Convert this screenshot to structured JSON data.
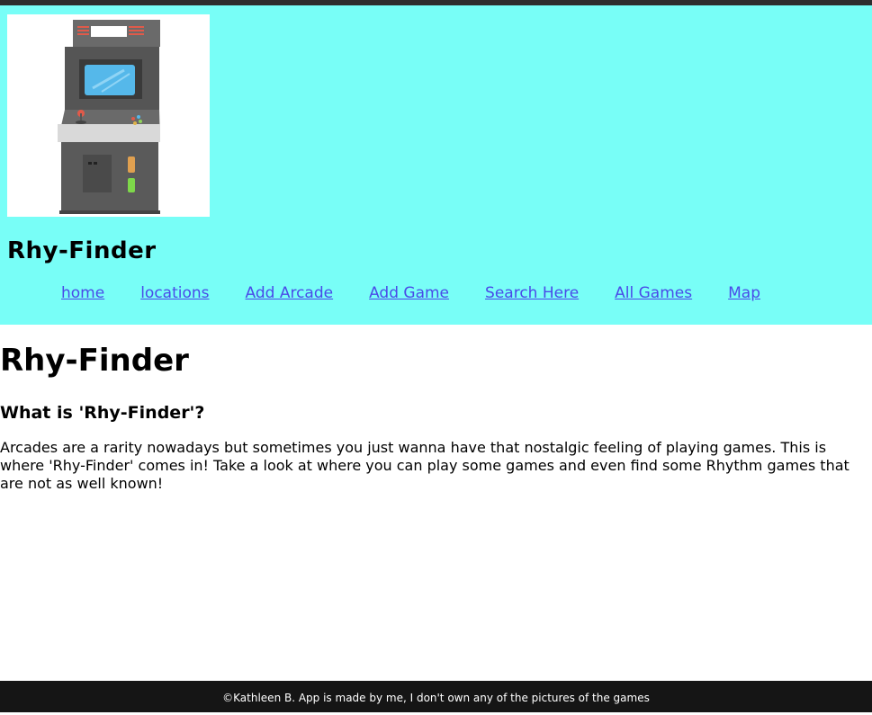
{
  "header": {
    "site_title": "Rhy-Finder",
    "logo_icon": "arcade-cabinet-icon",
    "background": "#78fef7"
  },
  "nav": {
    "items": [
      {
        "label": "home"
      },
      {
        "label": "locations"
      },
      {
        "label": "Add Arcade"
      },
      {
        "label": "Add Game"
      },
      {
        "label": "Search Here"
      },
      {
        "label": "All Games"
      },
      {
        "label": "Map"
      }
    ],
    "link_color": "#4a4ae8"
  },
  "main": {
    "title": "Rhy-Finder",
    "subtitle": "What is 'Rhy-Finder'?",
    "intro": "Arcades are a rarity nowadays but sometimes you just wanna have that nostalgic feeling of playing games. This is where 'Rhy-Finder' comes in! Take a look at where you can play some games and even find some Rhythm games that are not as well known!"
  },
  "footer": {
    "text": "©Kathleen B. App is made by me, I don't own any of the pictures of the games"
  }
}
